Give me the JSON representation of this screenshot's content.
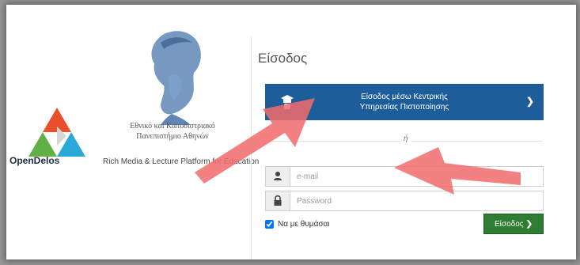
{
  "branding": {
    "university_line1": "Εθνικό και Καποδιστριακό",
    "university_line2": "Πανεπιστήμιο Αθηνών",
    "brand_name": "OpenDelos",
    "tagline": "Rich Media & Lecture Platform for Education"
  },
  "login": {
    "title": "Είσοδος",
    "cas_button": {
      "line1": "Είσοδος μέσω Κεντρικής",
      "line2": "Υπηρεσίας Πιστοποίησης",
      "icon": "graduation-cap-icon"
    },
    "separator": "ή",
    "email": {
      "placeholder": "e-mail",
      "value": "",
      "icon": "user-icon"
    },
    "password": {
      "placeholder": "Password",
      "value": "",
      "icon": "lock-icon"
    },
    "remember_label": "Να με θυμάσαι",
    "remember_checked": true,
    "submit_label": "Είσοδος"
  },
  "colors": {
    "cas_button": "#1d5d9a",
    "submit_button": "#2e7d32",
    "annotation_arrow": "#f16a6a"
  }
}
